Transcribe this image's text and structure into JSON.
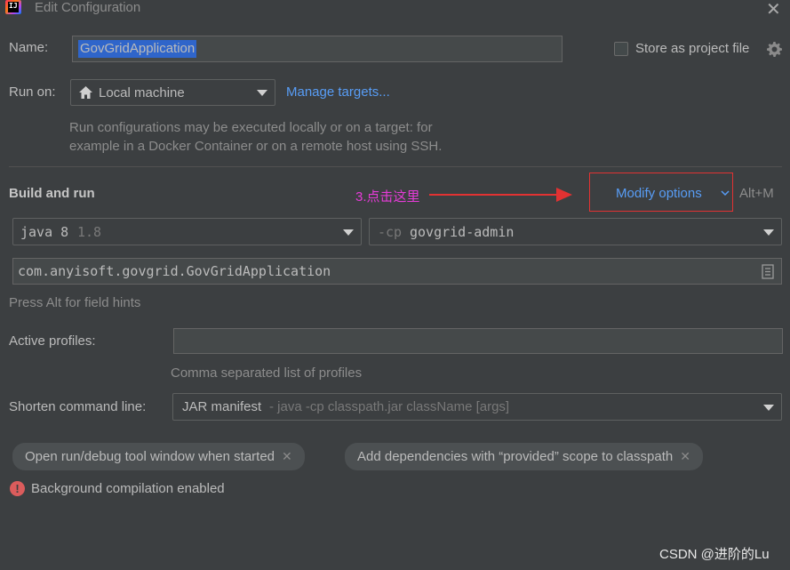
{
  "window": {
    "app_icon_text": "IJ",
    "title": "Edit Configuration",
    "close_glyph": "✕"
  },
  "name_row": {
    "label": "Name:",
    "value": "GovGridApplication",
    "store_label": "Store as project file",
    "store_checked": false
  },
  "run_on": {
    "label": "Run on:",
    "selected": "Local machine",
    "manage_link": "Manage targets...",
    "desc_line1": "Run configurations may be executed locally or on a target: for",
    "desc_line2": "example in a Docker Container or on a remote host using SSH."
  },
  "build_run": {
    "heading": "Build and run",
    "annotation": "3.点击这里",
    "modify_label": "Modify options",
    "modify_shortcut": "Alt+M",
    "jdk_name": "java 8",
    "jdk_version": "1.8",
    "cp_flag": "-cp",
    "cp_module": "govgrid-admin",
    "main_class": "com.anyisoft.govgrid.GovGridApplication",
    "field_hint": "Press Alt for field hints"
  },
  "profiles": {
    "label": "Active profiles:",
    "value": "",
    "hint": "Comma separated list of profiles"
  },
  "shorten": {
    "label": "Shorten command line:",
    "selected": "JAR manifest",
    "selected_desc": "- java -cp classpath.jar className [args]"
  },
  "tags": [
    {
      "label": "Open run/debug tool window when started"
    },
    {
      "label": "Add dependencies with “provided” scope to classpath"
    }
  ],
  "warning": {
    "text": "Background compilation enabled",
    "icon_glyph": "!"
  },
  "watermark": "CSDN @进阶的Lu",
  "colors": {
    "background": "#3c3f41",
    "link": "#589df6",
    "selection": "#2f65ca",
    "annotation": "#e63bd8",
    "annotation_box": "#e23232",
    "error_icon": "#db5c5c"
  }
}
